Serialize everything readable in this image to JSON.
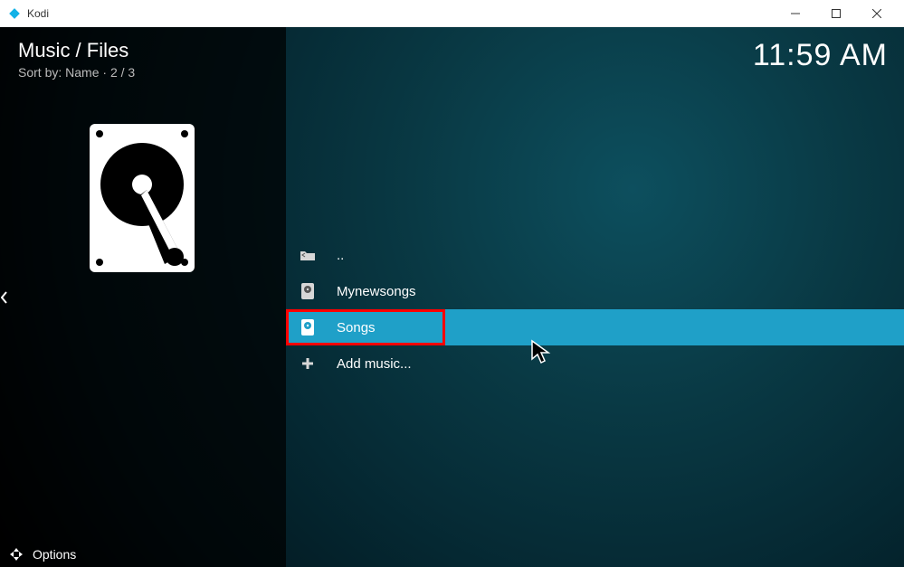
{
  "window": {
    "title": "Kodi"
  },
  "header": {
    "breadcrumb": "Music / Files",
    "sort_label": "Sort by: Name",
    "position": "2 / 3",
    "clock": "11:59 AM"
  },
  "list": {
    "items": [
      {
        "icon": "folder-back",
        "label": ".."
      },
      {
        "icon": "music-source",
        "label": "Mynewsongs"
      },
      {
        "icon": "music-source",
        "label": "Songs",
        "selected": true,
        "highlighted": true
      },
      {
        "icon": "plus",
        "label": "Add music..."
      }
    ]
  },
  "footer": {
    "options_label": "Options"
  }
}
